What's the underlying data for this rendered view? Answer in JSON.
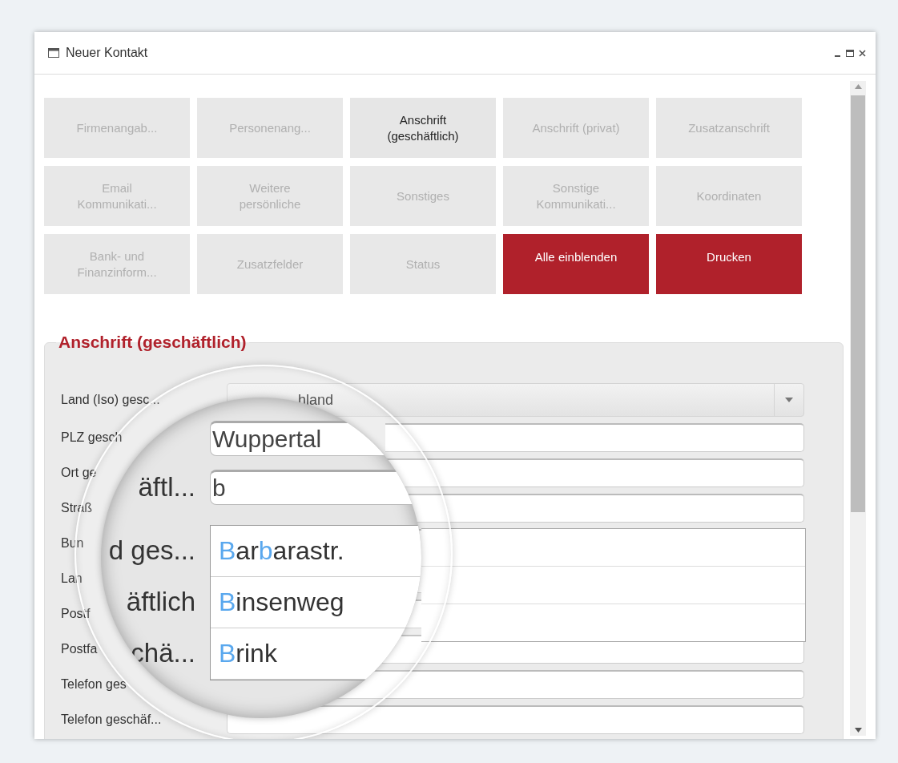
{
  "window": {
    "title": "Neuer Kontakt"
  },
  "tiles": [
    {
      "label": "Firmenangab...",
      "kind": "section",
      "selected": false
    },
    {
      "label": "Personenang...",
      "kind": "section",
      "selected": false
    },
    {
      "label": "Anschrift (geschäftlich)",
      "kind": "section",
      "selected": true
    },
    {
      "label": "Anschrift (privat)",
      "kind": "section",
      "selected": false
    },
    {
      "label": "Zusatzanschrift",
      "kind": "section",
      "selected": false
    },
    {
      "label": "Email Kommunikati...",
      "kind": "section",
      "selected": false
    },
    {
      "label": "Weitere persönliche",
      "kind": "section",
      "selected": false
    },
    {
      "label": "Sonstiges",
      "kind": "section",
      "selected": false
    },
    {
      "label": "Sonstige Kommunikati...",
      "kind": "section",
      "selected": false
    },
    {
      "label": "Koordinaten",
      "kind": "section",
      "selected": false
    },
    {
      "label": "Bank- und Finanzinform...",
      "kind": "section",
      "selected": false
    },
    {
      "label": "Zusatzfelder",
      "kind": "section",
      "selected": false
    },
    {
      "label": "Status",
      "kind": "section",
      "selected": false
    },
    {
      "label": "Alle einblenden",
      "kind": "action"
    },
    {
      "label": "Drucken",
      "kind": "action"
    }
  ],
  "form": {
    "legend": "Anschrift (geschäftlich)",
    "rows": [
      {
        "label": "Land (Iso) gesc...",
        "kind": "select",
        "value": "hland"
      },
      {
        "label": "PLZ gesch",
        "kind": "text"
      },
      {
        "label": "Ort ge",
        "kind": "text"
      },
      {
        "label": "Straß",
        "kind": "text"
      },
      {
        "label": "Bun",
        "kind": "text"
      },
      {
        "label": "Lan",
        "kind": "text"
      },
      {
        "label": "Postf",
        "kind": "text"
      },
      {
        "label": "Postfa",
        "kind": "text"
      },
      {
        "label": "Telefon ges",
        "kind": "text"
      },
      {
        "label": "Telefon geschäf...",
        "kind": "text"
      }
    ]
  },
  "magnifier": {
    "fields": [
      {
        "value": "Wuppertal"
      },
      {
        "label": "äftl...",
        "value": "b"
      }
    ],
    "suggestions": [
      {
        "label": "d ges...",
        "parts": [
          {
            "text": "B",
            "match": true
          },
          {
            "text": "ar",
            "match": false
          },
          {
            "text": "b",
            "match": true
          },
          {
            "text": "arastr.",
            "match": false
          }
        ]
      },
      {
        "label": "äftlich",
        "parts": [
          {
            "text": "B",
            "match": true
          },
          {
            "text": "insenweg",
            "match": false
          }
        ]
      },
      {
        "label": "chä...",
        "parts": [
          {
            "text": "B",
            "match": true
          },
          {
            "text": "rink",
            "match": false
          }
        ]
      }
    ]
  }
}
